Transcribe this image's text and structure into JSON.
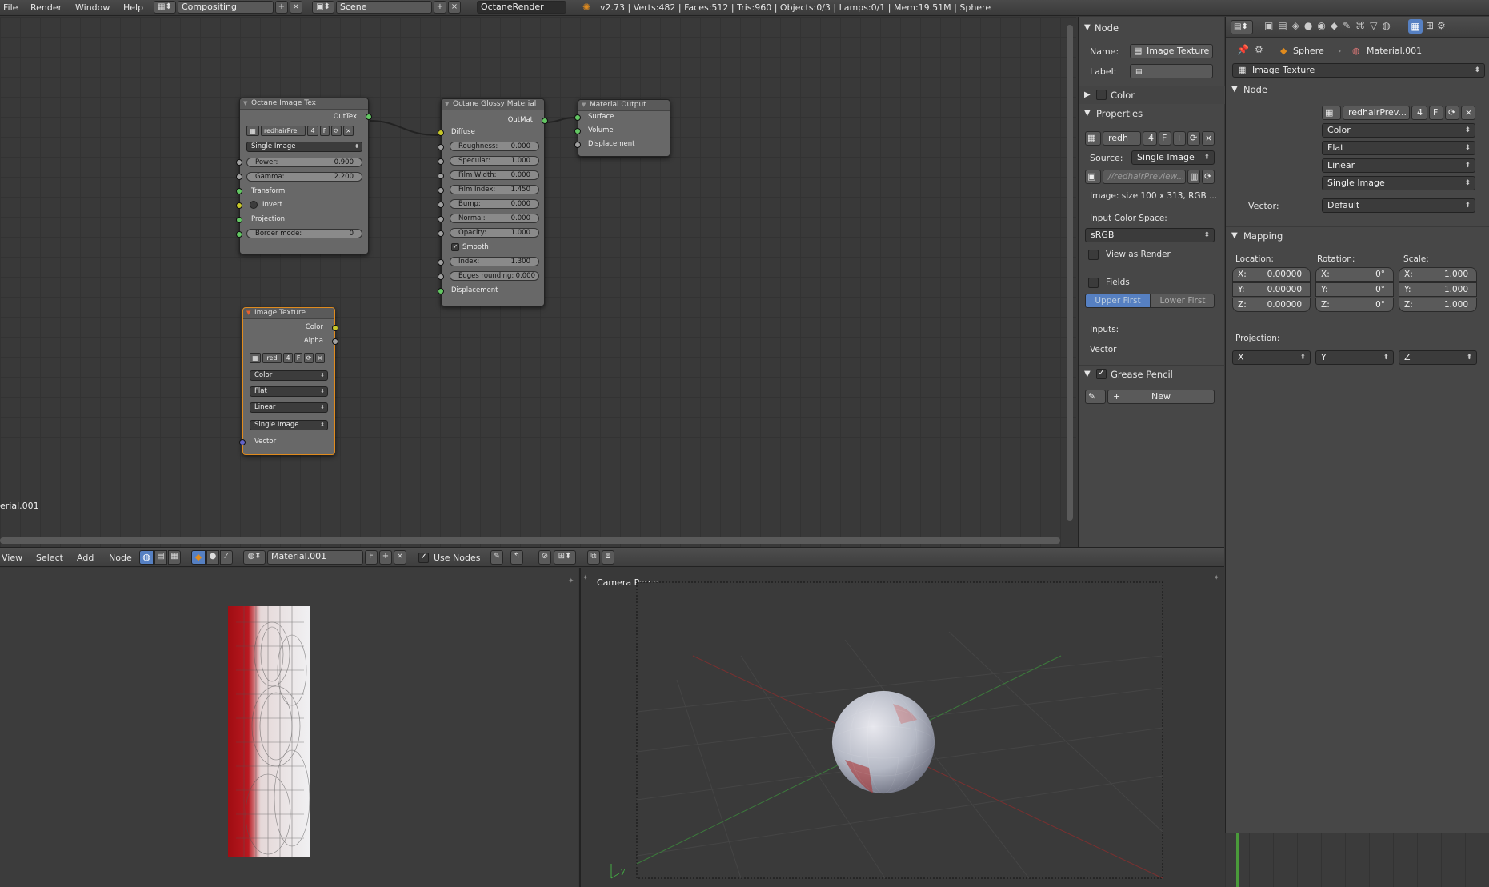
{
  "topbar": {
    "menus": [
      "File",
      "Render",
      "Window",
      "Help"
    ],
    "screen": "Compositing",
    "scene": "Scene",
    "engine": "OctaneRender",
    "stats": "v2.73 | Verts:482 | Faces:512 | Tris:960 | Objects:0/3 | Lamps:0/1 | Mem:19.51M | Sphere"
  },
  "nodes": {
    "image_tex": {
      "title": "Octane Image Tex",
      "output": "OutTex",
      "image_name": "redhairPre",
      "users": "4",
      "fake": "F",
      "source": "Single Image",
      "power_label": "Power:",
      "power": "0.900",
      "gamma_label": "Gamma:",
      "gamma": "2.200",
      "transform": "Transform",
      "invert": "Invert",
      "projection": "Projection",
      "border_label": "Border mode:",
      "border": "0"
    },
    "glossy": {
      "title": "Octane Glossy Material",
      "output": "OutMat",
      "diffuse": "Diffuse",
      "params": [
        {
          "label": "Roughness:",
          "value": "0.000"
        },
        {
          "label": "Specular:",
          "value": "1.000"
        },
        {
          "label": "Film Width:",
          "value": "0.000"
        },
        {
          "label": "Film Index:",
          "value": "1.450"
        },
        {
          "label": "Bump:",
          "value": "0.000"
        },
        {
          "label": "Normal:",
          "value": "0.000"
        },
        {
          "label": "Opacity:",
          "value": "1.000"
        }
      ],
      "smooth": "Smooth",
      "index_label": "Index:",
      "index": "1.300",
      "edges_label": "Edges rounding:",
      "edges": "0.000",
      "displacement": "Displacement"
    },
    "output": {
      "title": "Material Output",
      "inputs": [
        "Surface",
        "Volume",
        "Displacement"
      ]
    },
    "image_texture": {
      "title": "Image Texture",
      "outputs": [
        "Color",
        "Alpha"
      ],
      "image_name": "red",
      "users": "4",
      "fake": "F",
      "color": "Color",
      "interp": "Flat",
      "proj": "Linear",
      "source": "Single Image",
      "vector": "Vector"
    },
    "material_label": "erial.001"
  },
  "npanel": {
    "node_header": "Node",
    "name_label": "Name:",
    "name_value": "Image Texture",
    "label_label": "Label:",
    "color_header": "Color",
    "properties_header": "Properties",
    "image_name": "redh",
    "users": "4",
    "fake": "F",
    "source_label": "Source:",
    "source_value": "Single Image",
    "filepath": "//redhairPreview...",
    "image_info": "Image: size 100 x 313, RGB ...",
    "color_space_label": "Input Color Space:",
    "color_space": "sRGB",
    "view_as_render": "View as Render",
    "fields": "Fields",
    "upper_first": "Upper First",
    "lower_first": "Lower First",
    "inputs_label": "Inputs:",
    "vector_label": "Vector",
    "grease_pencil": "Grease Pencil",
    "new_button": "New"
  },
  "props": {
    "breadcrumb_object": "Sphere",
    "breadcrumb_material": "Material.001",
    "texture_type": "Image Texture",
    "node_header": "Node",
    "image_name": "redhairPrev...",
    "users": "4",
    "fake": "F",
    "color": "Color",
    "interp": "Flat",
    "proj": "Linear",
    "source": "Single Image",
    "vector_label": "Vector:",
    "vector_value": "Default",
    "mapping_header": "Mapping",
    "location_label": "Location:",
    "rotation_label": "Rotation:",
    "scale_label": "Scale:",
    "location": [
      {
        "axis": "X:",
        "value": "0.00000"
      },
      {
        "axis": "Y:",
        "value": "0.00000"
      },
      {
        "axis": "Z:",
        "value": "0.00000"
      }
    ],
    "rotation": [
      {
        "axis": "X:",
        "value": "0°"
      },
      {
        "axis": "Y:",
        "value": "0°"
      },
      {
        "axis": "Z:",
        "value": "0°"
      }
    ],
    "scale": [
      {
        "axis": "X:",
        "value": "1.000"
      },
      {
        "axis": "Y:",
        "value": "1.000"
      },
      {
        "axis": "Z:",
        "value": "1.000"
      }
    ],
    "projection_label": "Projection:",
    "projection": [
      "X",
      "Y",
      "Z"
    ]
  },
  "ne_header": {
    "menus": [
      "View",
      "Select",
      "Add",
      "Node"
    ],
    "material": "Material.001",
    "fake": "F",
    "use_nodes": "Use Nodes"
  },
  "view3d": {
    "label": "Camera Persp"
  },
  "colors": {
    "accent_orange": "#e08b1e",
    "selected_blue": "#5680c2",
    "socket_green": "#63c763",
    "socket_yellow": "#c7c729"
  }
}
